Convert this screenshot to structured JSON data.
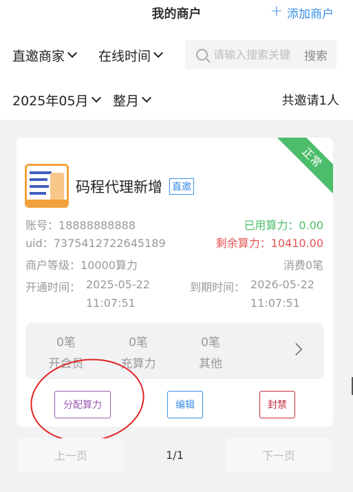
{
  "header": {
    "title": "我的商户",
    "add_label": "添加商户"
  },
  "filters": {
    "merchant_type": "直邀商家",
    "sort": "在线时间",
    "month": "2025年05月",
    "range": "整月"
  },
  "search": {
    "placeholder": "请输入搜索关键",
    "button": "搜索"
  },
  "summary": {
    "total": "共邀请1人"
  },
  "merchant": {
    "status": "正常",
    "name": "码程代理新增",
    "tag": "直邀",
    "account_label": "账号：",
    "account": "18888888888",
    "uid_label": "uid：",
    "uid": "7375412722645189",
    "used_label": "已用算力：",
    "used": "0.00",
    "remaining_label": "剩余算力：",
    "remaining": "10410.00",
    "level_label": "商户等级：",
    "level": "10000算力",
    "consumed": "消费0笔",
    "open_label": "开通时间：",
    "open_date": "2025-05-22",
    "open_time": "11:07:51",
    "expire_label": "到期时间：",
    "expire_date": "2026-05-22",
    "expire_time": "11:07:51",
    "stats": [
      {
        "count": "0笔",
        "label": "开会员"
      },
      {
        "count": "0笔",
        "label": "充算力"
      },
      {
        "count": "0笔",
        "label": "其他"
      }
    ],
    "actions": {
      "allocate": "分配算力",
      "edit": "编辑",
      "ban": "封禁"
    }
  },
  "pagination": {
    "prev": "上一页",
    "page": "1/1",
    "next": "下一页"
  },
  "colors": {
    "accent": "#3a8ee6",
    "status_green": "#4cbd6a",
    "remaining_red": "#e55353",
    "allocate_purple": "#9b59b6",
    "ban_red": "#c0283c",
    "annotation_red": "#e02020"
  }
}
